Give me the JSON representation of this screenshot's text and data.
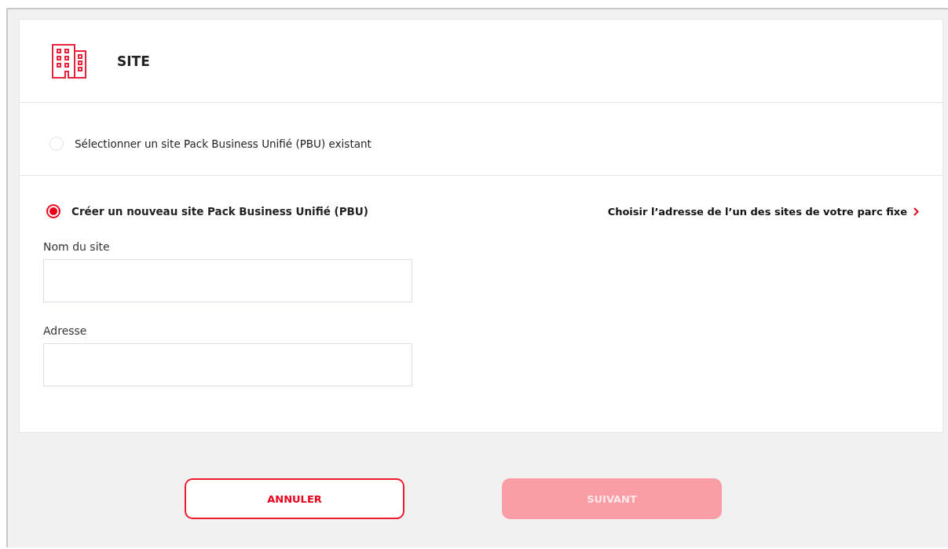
{
  "header": {
    "title": "SITE"
  },
  "options": [
    {
      "label": "Sélectionner un site Pack Business Unifié (PBU) existant",
      "selected": false
    },
    {
      "label": "Créer un nouveau site Pack Business Unifié (PBU)",
      "selected": true,
      "link": "Choisir l’adresse de l’un des sites de votre parc fixe",
      "fields": [
        {
          "label": "Nom du site"
        },
        {
          "label": "Adresse"
        }
      ]
    }
  ],
  "buttons": [
    {
      "label": "ANNULER",
      "kind": "secondary",
      "disabled": false
    },
    {
      "label": "SUIVANT",
      "kind": "primary",
      "disabled": true
    }
  ]
}
